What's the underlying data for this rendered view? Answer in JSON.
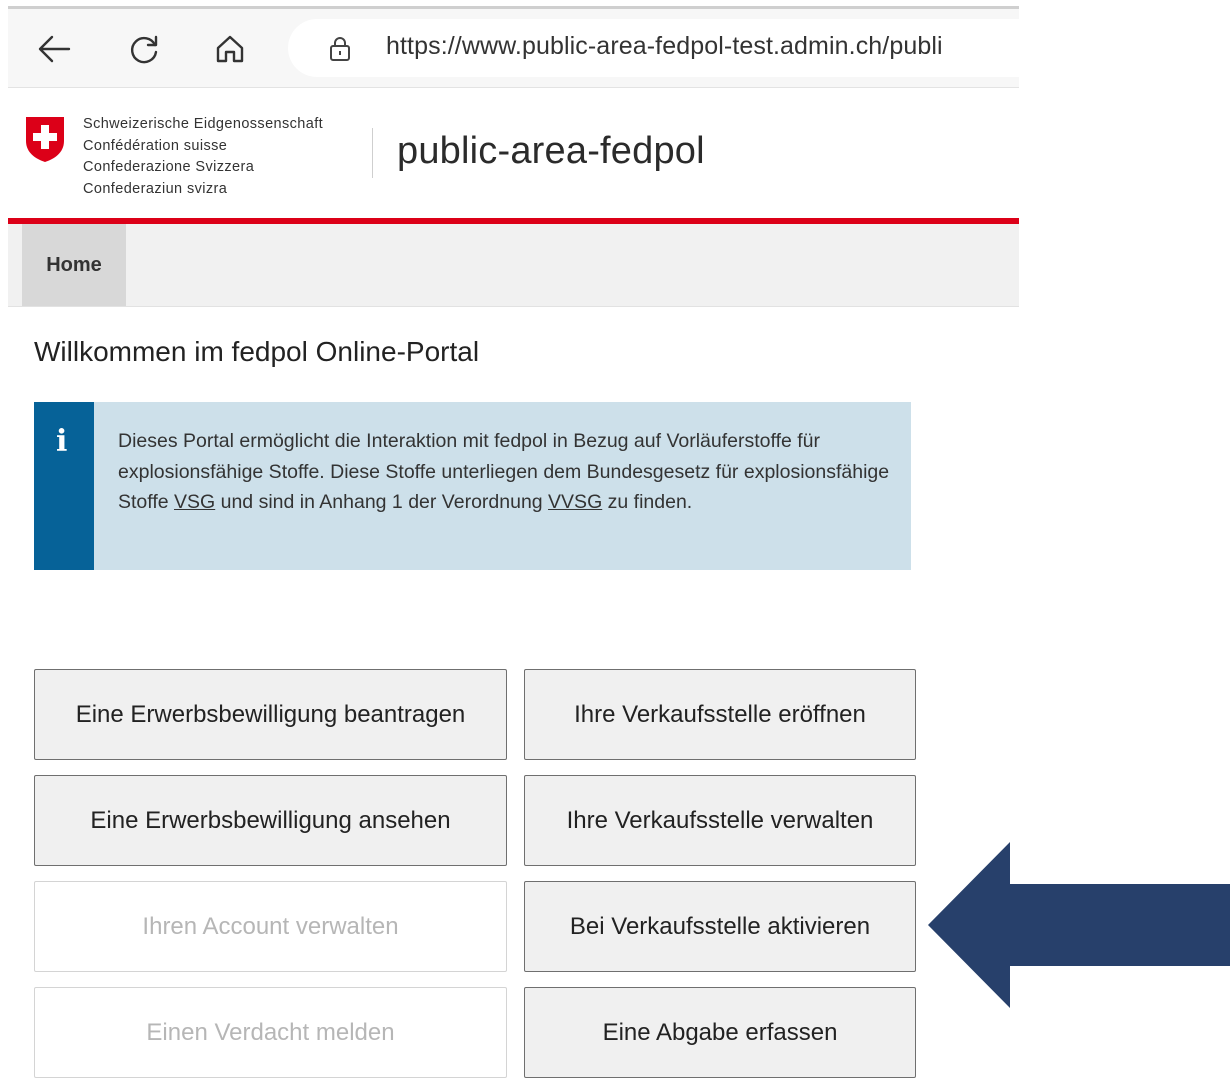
{
  "browser": {
    "url": "https://www.public-area-fedpol-test.admin.ch/publi"
  },
  "header": {
    "confederation_lines": [
      "Schweizerische Eidgenossenschaft",
      "Confédération suisse",
      "Confederazione Svizzera",
      "Confederaziun svizra"
    ],
    "site_title": "public-area-fedpol"
  },
  "nav": {
    "home_label": "Home"
  },
  "main": {
    "welcome_title": "Willkommen im fedpol Online-Portal",
    "info": {
      "text_before_vsg": "Dieses Portal ermöglicht die Interaktion mit fedpol in Bezug auf Vorläuferstoffe für explosionsfähige Stoffe. Diese Stoffe unterliegen dem Bundesgesetz für explosionsfähige Stoffe ",
      "link_vsg": "VSG",
      "text_between": " und sind in Anhang 1 der Verordnung ",
      "link_vvsg": "VVSG",
      "text_after": " zu finden."
    },
    "buttons": {
      "apply_permit": "Eine Erwerbsbewilligung beantragen",
      "open_outlet": "Ihre Verkaufsstelle eröffnen",
      "view_permit": "Eine Erwerbsbewilligung ansehen",
      "manage_outlet": "Ihre Verkaufsstelle verwalten",
      "manage_account": "Ihren Account verwalten",
      "activate_at_outlet": "Bei Verkaufsstelle aktivieren",
      "report_suspicion": "Einen Verdacht melden",
      "record_sale": "Eine Abgabe erfassen"
    }
  },
  "colors": {
    "swiss_red": "#dc0018",
    "info_bg": "#cde0ea",
    "info_stripe": "#066298",
    "arrow": "#27406b"
  }
}
